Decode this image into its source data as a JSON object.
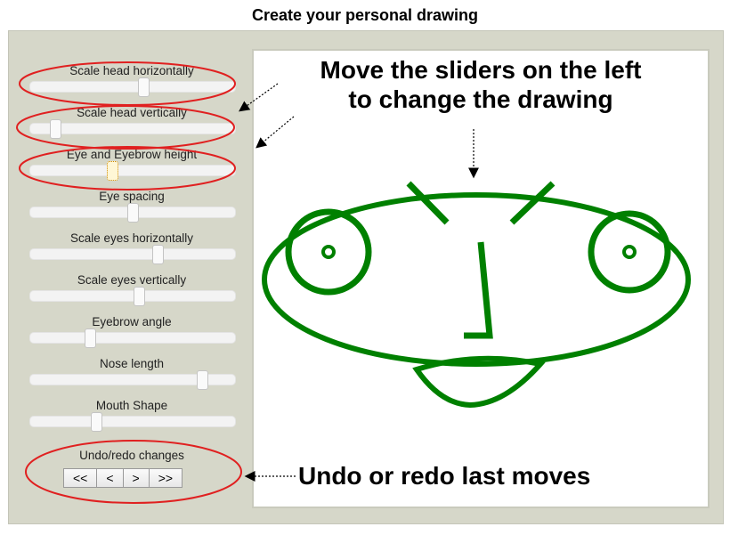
{
  "page": {
    "title": "Create your personal drawing"
  },
  "sliders": [
    {
      "label": "Scale head horizontally",
      "value": 0.55
    },
    {
      "label": "Scale head vertically",
      "value": 0.12
    },
    {
      "label": "Eye and Eyebrow height",
      "value": 0.4
    },
    {
      "label": "Eye spacing",
      "value": 0.5
    },
    {
      "label": "Scale eyes horizontally",
      "value": 0.62
    },
    {
      "label": "Scale eyes vertically",
      "value": 0.53
    },
    {
      "label": "Eyebrow angle",
      "value": 0.29
    },
    {
      "label": "Nose length",
      "value": 0.84
    },
    {
      "label": "Mouth Shape",
      "value": 0.32
    }
  ],
  "undo": {
    "label": "Undo/redo changes",
    "buttons": [
      "<<",
      "<",
      ">",
      ">>"
    ]
  },
  "annotations": {
    "sliders_hint": "Move the sliders on the left to change the drawing",
    "undo_hint": "Undo or redo last moves"
  },
  "colors": {
    "face": "#008000",
    "highlight": "#e02020",
    "panel": "#d6d7c9"
  },
  "icons": [
    "arrow-icon",
    "highlight-ellipse"
  ]
}
